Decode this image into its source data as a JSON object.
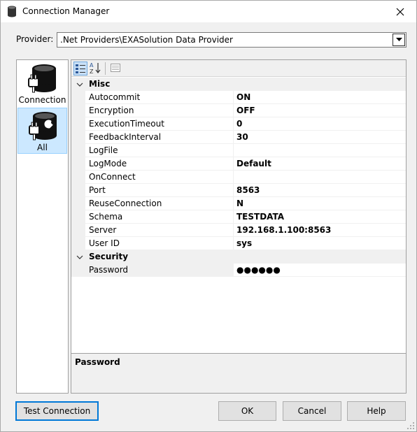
{
  "window": {
    "title": "Connection Manager"
  },
  "provider": {
    "label": "Provider:",
    "value": ".Net Providers\\EXASolution Data Provider"
  },
  "sidebar": {
    "items": [
      {
        "label": "Connection",
        "icon": "database-plug-icon",
        "selected": false
      },
      {
        "label": "All",
        "icon": "database-plug-wrench-icon",
        "selected": true
      }
    ]
  },
  "grid": {
    "categories": [
      {
        "name": "Misc",
        "properties": [
          {
            "name": "Autocommit",
            "value": "ON"
          },
          {
            "name": "Encryption",
            "value": "OFF"
          },
          {
            "name": "ExecutionTimeout",
            "value": "0"
          },
          {
            "name": "FeedbackInterval",
            "value": "30"
          },
          {
            "name": "LogFile",
            "value": ""
          },
          {
            "name": "LogMode",
            "value": "Default"
          },
          {
            "name": "OnConnect",
            "value": ""
          },
          {
            "name": "Port",
            "value": "8563"
          },
          {
            "name": "ReuseConnection",
            "value": "N"
          },
          {
            "name": "Schema",
            "value": "TESTDATA"
          },
          {
            "name": "Server",
            "value": "192.168.1.100:8563"
          },
          {
            "name": "User ID",
            "value": "sys"
          }
        ]
      },
      {
        "name": "Security",
        "properties": [
          {
            "name": "Password",
            "value": "●●●●●●"
          }
        ]
      }
    ],
    "selected_property": "Password",
    "description": {
      "title": "Password"
    }
  },
  "buttons": {
    "test": "Test Connection",
    "ok": "OK",
    "cancel": "Cancel",
    "help": "Help"
  },
  "colors": {
    "selection": "#cce8ff",
    "default_button_border": "#0078d7"
  }
}
